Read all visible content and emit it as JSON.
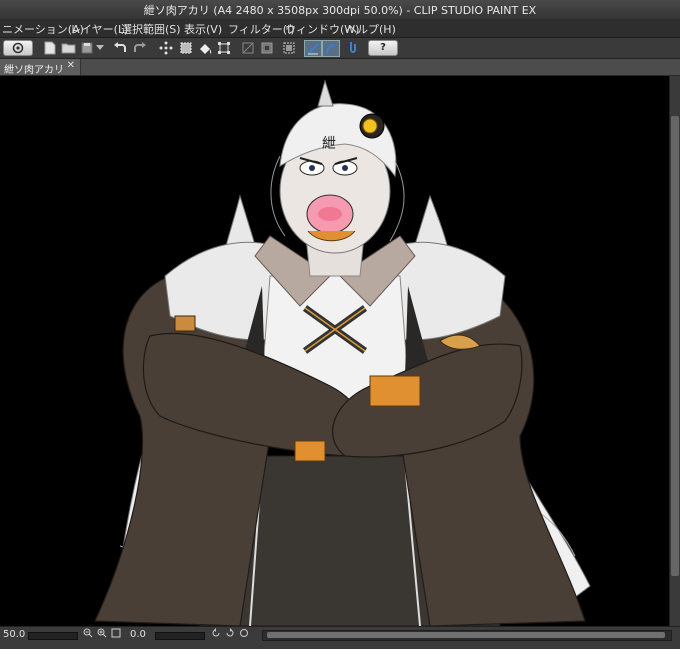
{
  "window": {
    "title": "紲ソ肉アカリ (A4 2480 x 3508px 300dpi 50.0%)  - CLIP STUDIO PAINT EX"
  },
  "menu": {
    "items": [
      {
        "label": "ニメーション(A)"
      },
      {
        "label": "レイヤー(L)"
      },
      {
        "label": "選択範囲(S)"
      },
      {
        "label": "表示(V)"
      },
      {
        "label": "フィルター(I)"
      },
      {
        "label": "ウィンドウ(W)"
      },
      {
        "label": "ヘルプ(H)"
      }
    ]
  },
  "toolbar": {
    "help_label": "?"
  },
  "document": {
    "tab_label": "紲ソ肉アカリ",
    "close_glyph": "✕",
    "forehead_text": "紲"
  },
  "status": {
    "zoom": "50.0",
    "rotation": "0.0"
  },
  "colors": {
    "accent": "#3a7fd0",
    "background": "#000000"
  }
}
